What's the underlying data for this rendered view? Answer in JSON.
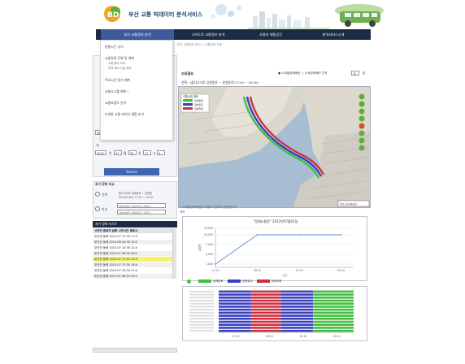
{
  "header": {
    "logo_initials": "BD",
    "logo_title": "부산 교통 빅데이터 분석서비스"
  },
  "nav": {
    "items": [
      {
        "label": "부산 교통정보 분석",
        "active": true
      },
      {
        "label": "고속도로 교통정보 분석",
        "active": false
      },
      {
        "label": "사용자 체험공간",
        "active": false
      },
      {
        "label": "분석서비스소개",
        "active": false
      }
    ]
  },
  "breadcrumb": "부산 교통정보 분석 > 교통정체 조회",
  "dropdown": {
    "items": [
      {
        "label": "통행시간 추이",
        "sub": []
      },
      {
        "label": "교통정체 진행 및 해제",
        "sub": [
          "교통정체 조회",
          "정체 해소시점 예측"
        ]
      },
      {
        "label": "주요시간 정기 예측",
        "sub": []
      },
      {
        "label": "교통사고를 예측 I",
        "sub": []
      },
      {
        "label": "교통흐름도 분석",
        "sub": []
      },
      {
        "label": "다양한 교통 데이터 결합 분석",
        "sub": []
      }
    ]
  },
  "sidebar": {
    "date_rows": [
      {
        "year": "2013",
        "month": "07",
        "day": "08",
        "hour": "12",
        "min": "0"
      },
      {
        "year": "2013",
        "month": "07",
        "day": "09",
        "hour": "17",
        "min": "0"
      }
    ],
    "to_label": "To",
    "search_label": "Search",
    "compare_title": "과거 정체 비교",
    "compare_options": [
      {
        "label": "선택",
        "lines": [
          "출사고가로 김현동로 ~ 온방동",
          "2013/07/02 17:10 ~ 20:50"
        ]
      },
      {
        "label": "비교",
        "lines": [
          "정체흐름을 선택하세요 (과정이..",
          "정체흐름을 선택하세요 (과정이.."
        ]
      }
    ],
    "list_title": "과거 정체 리스트",
    "list_header": [
      "시작지",
      "종료지",
      "날짜",
      "시작시간",
      "종료시"
    ],
    "list_rows": [
      "부산진 동래 2013.07 17:30 17:5",
      "부산진 동래 2013.08 19:30 20:2",
      "부산진 동래 2013.07 10:30 11:0",
      "부산진 동래 2013.07 08:00 08:1",
      "부산진 동래 2013.07 17:10 20:5",
      "부산진 동래 2013.07 17:30 18:4",
      "부산진 동래 2013.07 19:30 21:0",
      "부산진 동래 2013.07 08:10 09:3"
    ]
  },
  "result": {
    "title": "조회결과",
    "options": "● 시계열정체패턴 ○ 누적정체패턴 간격",
    "interval": "10",
    "selection": "선택 : (출사고가로 김현동로 ~ 온방동로(17:10 ~ 20:50)",
    "legend": [
      {
        "label": "정체완화",
        "color": "#3fbf3f"
      },
      {
        "label": "정체유지",
        "color": "#3a3fbf"
      },
      {
        "label": "정체악화",
        "color": "#cf3040"
      }
    ],
    "map_note": "* 시계열정체패턴은 최통4시간부터 표현됩니다",
    "map_link": "제목",
    "fullscreen_label": "FULLSCREEN",
    "chart_title": "\"정체교통량\" 2013년07월02일",
    "chart_legend": [
      "정체완화",
      "정체유지",
      "정체악화"
    ],
    "chart_legend_colors": [
      "#3fbf3f",
      "#3a3fbf",
      "#cf3040"
    ]
  },
  "chart_data": [
    {
      "type": "line",
      "title": "\"정체교통량\" 2013년07월02일",
      "x": [
        "17:10",
        "18:10",
        "19:10",
        "20:10"
      ],
      "y": [
        1000,
        10000,
        10000,
        10000
      ],
      "ylim": [
        0,
        12000
      ],
      "yticks": [
        "1,000",
        "4,000",
        "7,000",
        "10,000",
        "13,000"
      ],
      "xlabel": "시간",
      "ylabel": "교통량"
    },
    {
      "type": "heatmap",
      "categories": [
        "17:10",
        "18:10",
        "19:10",
        "20:10"
      ],
      "row_count": 14,
      "segments": [
        {
          "from": 0.0,
          "to": 0.24,
          "color": "#3a3fbf"
        },
        {
          "from": 0.24,
          "to": 0.46,
          "color": "#cf3040"
        },
        {
          "from": 0.46,
          "to": 0.7,
          "color": "#3a3fbf"
        },
        {
          "from": 0.7,
          "to": 1.0,
          "color": "#3fbf3f"
        }
      ]
    }
  ]
}
